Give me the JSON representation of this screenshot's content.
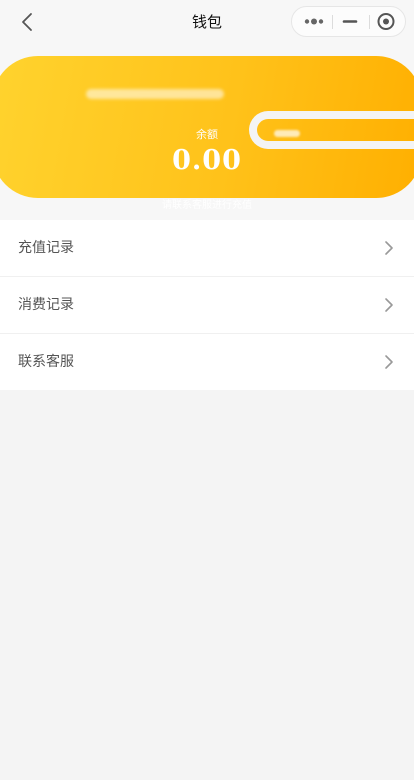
{
  "nav": {
    "title": "钱包",
    "back_icon": "chevron-left-icon",
    "capsule_icons": [
      "more-dots-icon",
      "minimize-icon",
      "close-target-icon"
    ]
  },
  "wallet": {
    "balance_label": "余额",
    "balance_amount": "0.00",
    "hint": "请联系客服进行充值",
    "accent_gradient": [
      "#ffd32e",
      "#ffaf00"
    ]
  },
  "menu": {
    "items": [
      {
        "label": "充值记录",
        "icon": "chevron-right-icon"
      },
      {
        "label": "消费记录",
        "icon": "chevron-right-icon"
      },
      {
        "label": "联系客服",
        "icon": "chevron-right-icon"
      }
    ]
  }
}
